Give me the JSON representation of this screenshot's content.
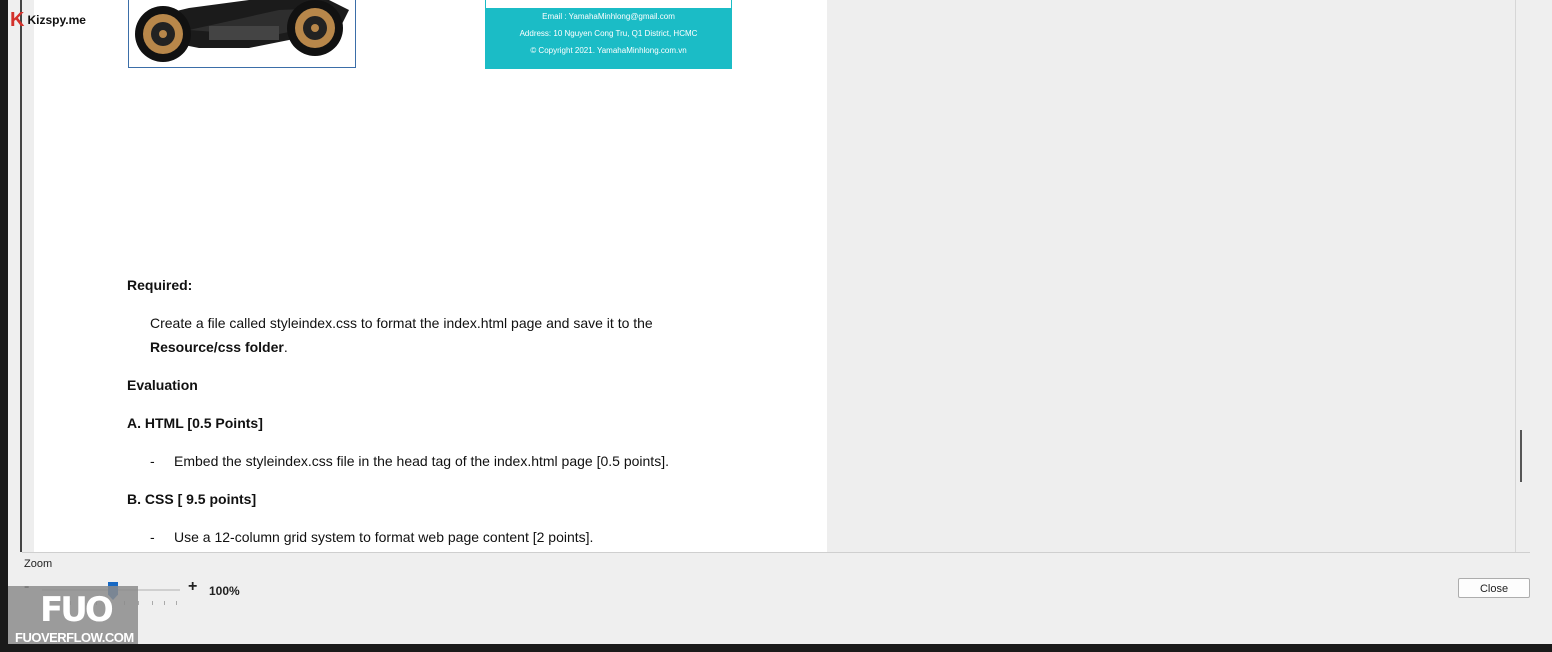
{
  "watermark": {
    "kizspy_k": "K",
    "kizspy_label": "Kizspy.me",
    "fuo_big": "FUO",
    "fuo_small": "FUOVERFLOW.COM"
  },
  "document": {
    "footer_email": "Email : YamahaMinhlong@gmail.com",
    "footer_address": "Address: 10 Nguyen Cong Tru, Q1 District, HCMC",
    "footer_copyright": "© Copyright 2021. YamahaMinhlong.com.vn",
    "required_heading": "Required:",
    "required_line1": "Create a file called styleindex.css to format the index.html page and save it to the",
    "required_line2_bold": "Resource/css  folder",
    "required_line2_end": ".",
    "evaluation_heading": "Evaluation",
    "section_a": "A. HTML  [0.5 Points]",
    "item_a1": "Embed the styleindex.css file in the head tag of the index.html page [0.5 points].",
    "section_b": "B. CSS  [ 9.5 points]",
    "item_b1": "Use a 12-column grid system to format web page content [2 points].",
    "dash": "-"
  },
  "zoom": {
    "label": "Zoom",
    "minus": "-",
    "plus": "+",
    "value": "100%",
    "level_percent": 100
  },
  "buttons": {
    "close": "Close"
  }
}
